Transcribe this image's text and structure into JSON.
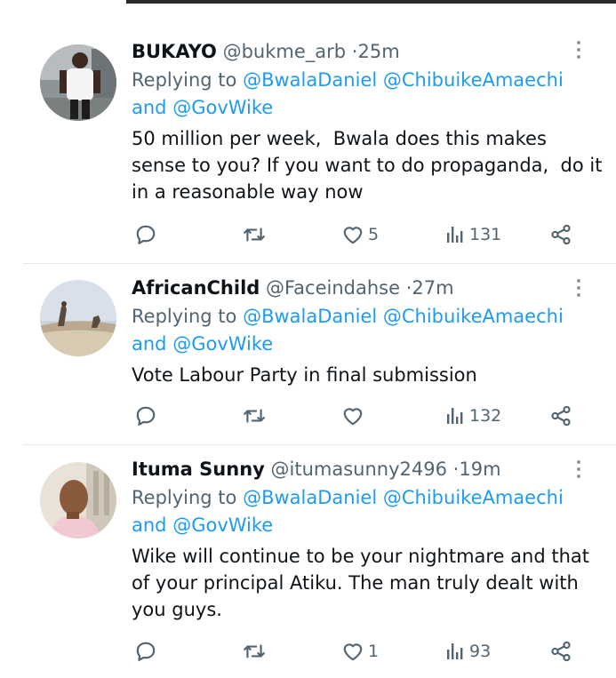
{
  "reply_prefix": "Replying to",
  "and_word": "and",
  "tweets": [
    {
      "name": "BUKAYO",
      "handle": "@bukme_arb",
      "time": "25m",
      "mentions": [
        "@BwalaDaniel",
        "@ChibuikeAmaechi",
        "@GovWike"
      ],
      "lines": [
        "50 million per week,  Bwala does this makes",
        "sense to you? If you want to do propaganda,  do it",
        "in a reasonable way now"
      ],
      "likes": "5",
      "views": "131"
    },
    {
      "name": "AfricanChild",
      "handle": "@Faceindahse",
      "time": "27m",
      "mentions": [
        "@BwalaDaniel",
        "@ChibuikeAmaechi",
        "@GovWike"
      ],
      "lines": [
        "Vote Labour Party in final submission"
      ],
      "likes": "",
      "views": "132"
    },
    {
      "name": "Ituma Sunny",
      "handle": "@itumasunny2496",
      "time": "19m",
      "mentions": [
        "@BwalaDaniel",
        "@ChibuikeAmaechi",
        "@GovWike"
      ],
      "lines": [
        "Wike will continue to be your nightmare and that",
        "of your principal Atiku. The man truly dealt with",
        "you guys."
      ],
      "likes": "1",
      "views": "93"
    }
  ],
  "colors": {
    "text": "#0f1419",
    "secondary": "#536471",
    "mention": "#1d9bf0",
    "divider": "#e6e9ec"
  },
  "icons": [
    "reply-icon",
    "retweet-icon",
    "like-icon",
    "views-icon",
    "share-icon",
    "more-icon"
  ]
}
